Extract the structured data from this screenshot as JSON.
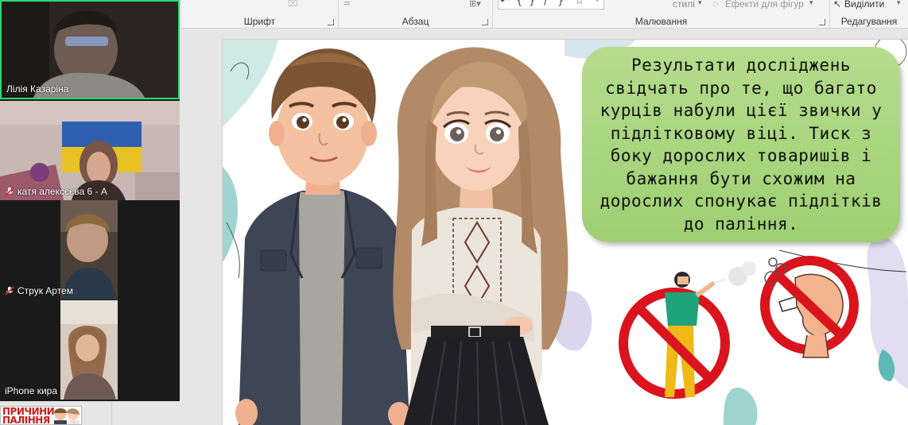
{
  "ribbon": {
    "groups": [
      {
        "label": "Шрифт"
      },
      {
        "label": "Абзац"
      },
      {
        "label": "Малювання"
      },
      {
        "label": "Редагування"
      }
    ],
    "styles_label": "стилі",
    "effects_label": "Ефекти для фігур",
    "select_label": "Виділити"
  },
  "participants": [
    {
      "name": "Лілія Казаріна",
      "muted": false,
      "active": true
    },
    {
      "name": "катя алексєєва 6 - А",
      "muted": true,
      "active": false
    },
    {
      "name": "Струк Артем",
      "muted": true,
      "active": false
    },
    {
      "name": "iPhone кира",
      "muted": false,
      "active": false
    }
  ],
  "slide": {
    "text": "Результати досліджень свідчать про те, що багато курців набули цієї звички у підлітковому віці. Тиск з боку дорослих товаришів і бажання бути схожим на дорослих спонукає підлітків до паління."
  },
  "thumbnail": {
    "text": "ПРИЧИНИ ПАЛІННЯ"
  },
  "colors": {
    "active_speaker": "#2bd96f",
    "textbox_fill": "#a8d47e",
    "no_sign": "#d9141c"
  }
}
